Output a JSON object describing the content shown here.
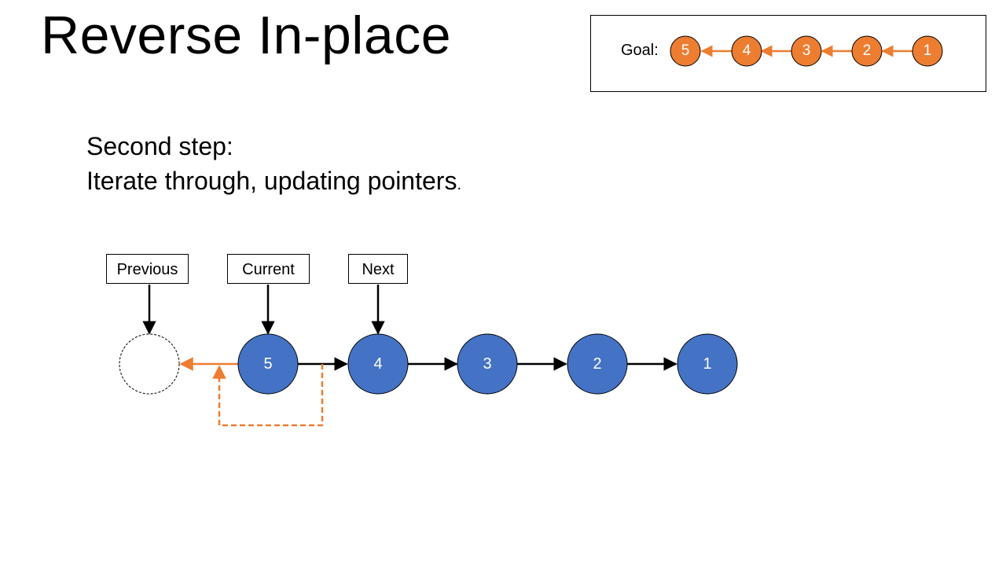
{
  "slide": {
    "title": "Reverse In-place",
    "instruction_line1": "Second step:",
    "instruction_line2": "Iterate through, updating pointers",
    "instruction_period": "."
  },
  "pointers": {
    "previous": "Previous",
    "current": "Current",
    "next": "Next"
  },
  "list_nodes": [
    "5",
    "4",
    "3",
    "2",
    "1"
  ],
  "goal": {
    "label": "Goal:",
    "nodes": [
      "5",
      "4",
      "3",
      "2",
      "1"
    ]
  },
  "colors": {
    "node_blue": "#4472C4",
    "accent_orange": "#ED7D31",
    "line_black": "#000000"
  }
}
